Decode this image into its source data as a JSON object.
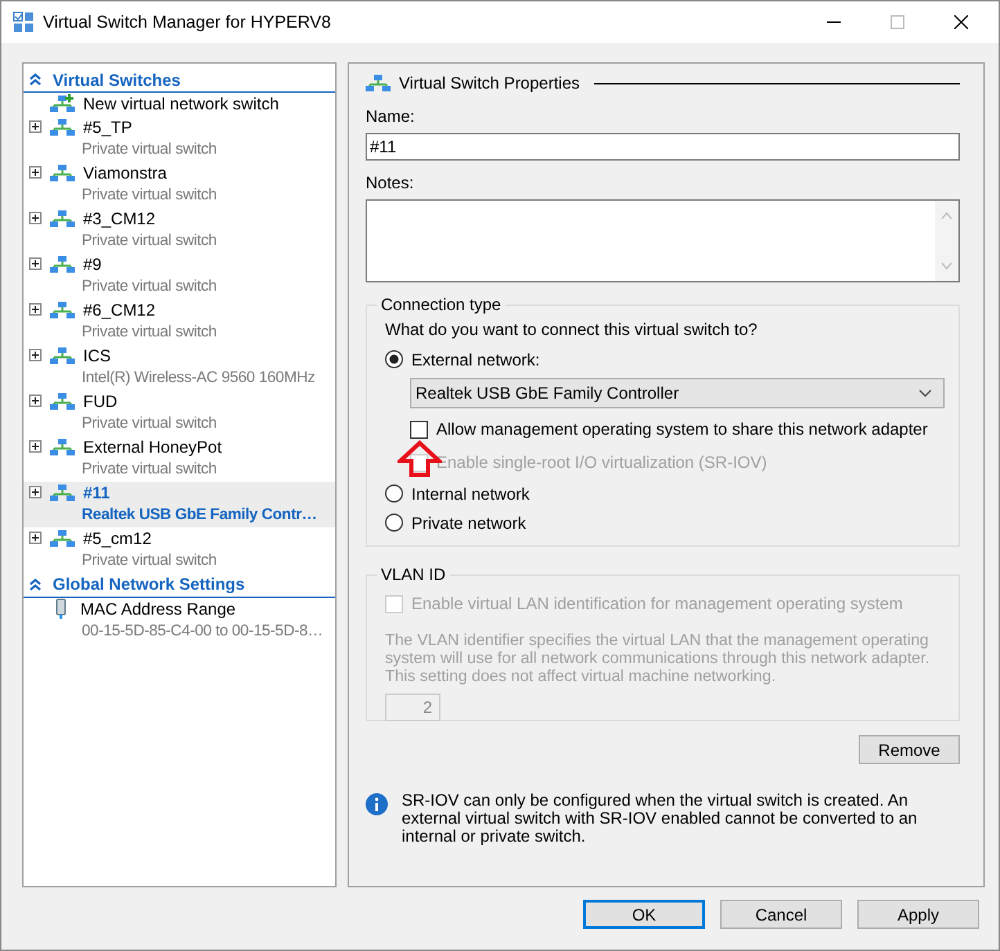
{
  "window": {
    "title": "Virtual Switch Manager for HYPERV8"
  },
  "sidebar": {
    "sections": [
      {
        "title": "Virtual Switches",
        "expanded": true,
        "items": [
          {
            "kind": "new",
            "name": "New virtual network switch",
            "selected": false
          },
          {
            "kind": "switch",
            "name": "#5_TP",
            "detail": "Private virtual switch",
            "selected": false
          },
          {
            "kind": "switch",
            "name": "Viamonstra",
            "detail": "Private virtual switch",
            "selected": false
          },
          {
            "kind": "switch",
            "name": "#3_CM12",
            "detail": "Private virtual switch",
            "selected": false
          },
          {
            "kind": "switch",
            "name": "#9",
            "detail": "Private virtual switch",
            "selected": false
          },
          {
            "kind": "switch",
            "name": "#6_CM12",
            "detail": "Private virtual switch",
            "selected": false
          },
          {
            "kind": "switch",
            "name": "ICS",
            "detail": "Intel(R) Wireless-AC 9560 160MHz",
            "selected": false
          },
          {
            "kind": "switch",
            "name": "FUD",
            "detail": "Private virtual switch",
            "selected": false
          },
          {
            "kind": "switch",
            "name": "External HoneyPot",
            "detail": "Private virtual switch",
            "selected": false
          },
          {
            "kind": "switch",
            "name": "#11",
            "detail": "Realtek USB GbE Family Contr…",
            "selected": true
          },
          {
            "kind": "switch",
            "name": "#5_cm12",
            "detail": "Private virtual switch",
            "selected": false
          }
        ]
      },
      {
        "title": "Global Network Settings",
        "expanded": true,
        "items": [
          {
            "kind": "mac",
            "name": "MAC Address Range",
            "detail": "00-15-5D-85-C4-00 to 00-15-5D-8…",
            "selected": false
          }
        ]
      }
    ]
  },
  "properties": {
    "header": "Virtual Switch Properties",
    "name_label": "Name:",
    "name_value": "#11",
    "notes_label": "Notes:",
    "connection": {
      "legend": "Connection type",
      "question": "What do you want to connect this virtual switch to?",
      "options": [
        {
          "label": "External network:",
          "selected": true,
          "adapter": "Realtek USB GbE Family Controller",
          "checkboxes": [
            {
              "label": "Allow management operating system to share this network adapter",
              "checked": false,
              "disabled": false
            },
            {
              "label": "Enable single-root I/O virtualization (SR-IOV)",
              "checked": false,
              "disabled": true
            }
          ]
        },
        {
          "label": "Internal network",
          "selected": false
        },
        {
          "label": "Private network",
          "selected": false
        }
      ]
    },
    "vlan": {
      "legend": "VLAN ID",
      "checkbox": {
        "label": "Enable virtual LAN identification for management operating system",
        "checked": false,
        "disabled": true
      },
      "description": "The VLAN identifier specifies the virtual LAN that the management operating system will use for all network communications through this network adapter. This setting does not affect virtual machine networking.",
      "vlan_id": "2"
    },
    "remove_button": "Remove",
    "info": "SR-IOV can only be configured when the virtual switch is created. An external virtual switch with SR-IOV enabled cannot be converted to an internal or private switch."
  },
  "buttons": [
    {
      "label": "OK",
      "default": true
    },
    {
      "label": "Cancel",
      "default": false
    },
    {
      "label": "Apply",
      "default": false
    }
  ]
}
